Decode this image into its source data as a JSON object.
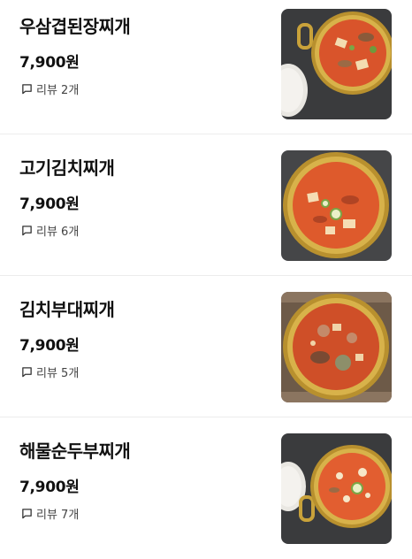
{
  "menu": {
    "items": [
      {
        "name": "우삼겹된장찌개",
        "price": "7,900원",
        "review_label": "리뷰 2개",
        "icon": "comment-icon",
        "image": "doenjang-stew-photo"
      },
      {
        "name": "고기김치찌개",
        "price": "7,900원",
        "review_label": "리뷰 6개",
        "icon": "comment-icon",
        "image": "kimchi-stew-photo"
      },
      {
        "name": "김치부대찌개",
        "price": "7,900원",
        "review_label": "리뷰 5개",
        "icon": "comment-icon",
        "image": "budae-stew-photo"
      },
      {
        "name": "해물순두부찌개",
        "price": "7,900원",
        "review_label": "리뷰 7개",
        "icon": "comment-icon",
        "image": "sundubu-stew-photo"
      }
    ]
  },
  "colors": {
    "text": "#111111",
    "subtext": "#444444",
    "divider": "#ececec",
    "pot_gold": "#c9a23a",
    "stew_red": "#d9542b",
    "table_dark": "#3a3b3d"
  }
}
